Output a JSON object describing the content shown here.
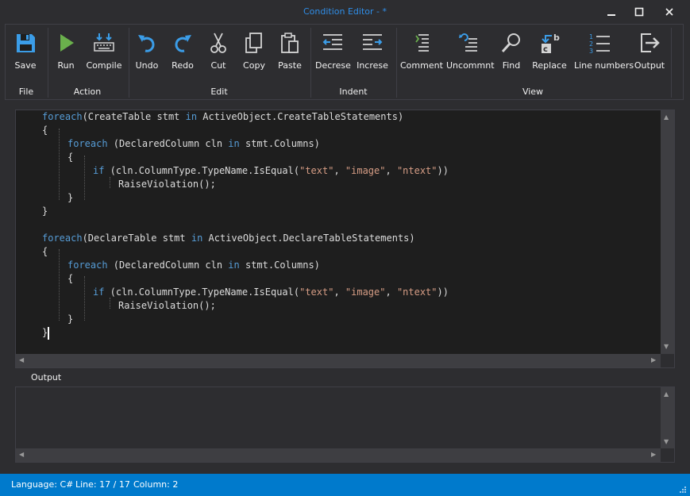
{
  "window": {
    "title": "Condition Editor - *",
    "controls": {
      "minimize": "minimize-icon",
      "maximize": "maximize-icon",
      "close": "close-icon"
    }
  },
  "ribbon": {
    "groups": {
      "file": "File",
      "action": "Action",
      "edit": "Edit",
      "indent": "Indent",
      "view": "View"
    },
    "buttons": {
      "save": "Save",
      "run": "Run",
      "compile": "Compile",
      "undo": "Undo",
      "redo": "Redo",
      "cut": "Cut",
      "copy": "Copy",
      "paste": "Paste",
      "decrease": "Decrese",
      "increase": "Increse",
      "comment": "Comment",
      "uncomment": "Uncommnt",
      "find": "Find",
      "replace": "Replace",
      "line_numbers": "Line numbers",
      "output": "Output"
    },
    "icons": {
      "save": "floppy-disk-icon",
      "run": "play-icon",
      "compile": "compile-icon",
      "undo": "undo-icon",
      "redo": "redo-icon",
      "cut": "scissors-icon",
      "copy": "copy-icon",
      "paste": "clipboard-icon",
      "decrease": "outdent-icon",
      "increase": "indent-icon",
      "comment": "comment-lines-icon",
      "uncomment": "uncomment-icon",
      "find": "magnifier-icon",
      "replace": "replace-icon",
      "line_numbers": "line-numbers-icon",
      "output": "output-arrow-icon"
    },
    "icon_colors": {
      "primary": "#3b9de8",
      "run": "#6ab04c",
      "light": "#d4d4d4"
    }
  },
  "editor": {
    "code": {
      "l1": {
        "kw": "foreach",
        "rest": "(CreateTable stmt ",
        "kw2": "in",
        "rest2": " ActiveObject.CreateTableStatements)"
      },
      "l2": "{",
      "l3": {
        "kw": "foreach",
        "rest": " (DeclaredColumn cln ",
        "kw2": "in",
        "rest2": " stmt.Columns)"
      },
      "l4": "{",
      "l5": {
        "kw": "if",
        "rest": " (cln.ColumnType.TypeName.IsEqual(",
        "s1": "\"text\"",
        "c1": ", ",
        "s2": "\"image\"",
        "c2": ", ",
        "s3": "\"ntext\"",
        "end": "))"
      },
      "l6": "RaiseViolation();",
      "l7": "}",
      "l8": "}",
      "l10": {
        "kw": "foreach",
        "rest": "(DeclareTable stmt ",
        "kw2": "in",
        "rest2": " ActiveObject.DeclareTableStatements)"
      },
      "l11": "{",
      "l12": {
        "kw": "foreach",
        "rest": " (DeclaredColumn cln ",
        "kw2": "in",
        "rest2": " stmt.Columns)"
      },
      "l13": "{",
      "l14": {
        "kw": "if",
        "rest": " (cln.ColumnType.TypeName.IsEqual(",
        "s1": "\"text\"",
        "c1": ", ",
        "s2": "\"image\"",
        "c2": ", ",
        "s3": "\"ntext\"",
        "end": "))"
      },
      "l15": "RaiseViolation();",
      "l16": "}",
      "l17": "}"
    },
    "syntax_colors": {
      "keyword": "#569cd6",
      "string": "#d69d85",
      "text": "#dcdcdc",
      "background": "#1e1e1e"
    }
  },
  "output": {
    "label": "Output"
  },
  "status": {
    "language": "Language: C#",
    "line": "Line: 17 / 17",
    "column": "Column: 2"
  },
  "theme": {
    "accent": "#007acc",
    "chrome": "#2d2d30"
  }
}
